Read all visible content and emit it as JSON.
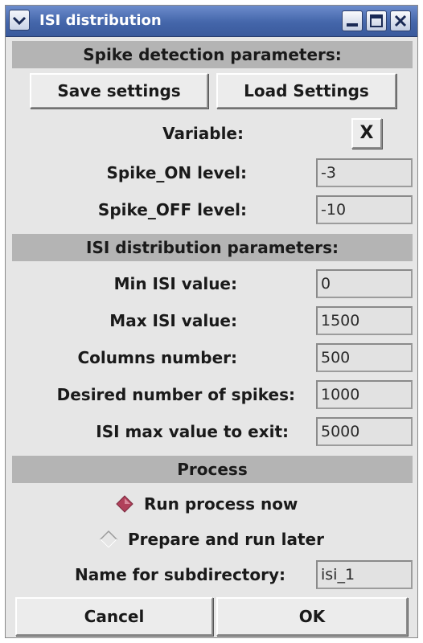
{
  "window": {
    "title": "ISI distribution"
  },
  "spike_section": {
    "header": "Spike detection parameters:",
    "save_label": "Save settings",
    "load_label": "Load Settings",
    "variable_label": "Variable:",
    "variable_value": "X",
    "on_label": "Spike_ON level:",
    "on_value": "-3",
    "off_label": "Spike_OFF level:",
    "off_value": "-10"
  },
  "isi_section": {
    "header": "ISI distribution parameters:",
    "fields": [
      {
        "label": "Min ISI value:",
        "value": "0"
      },
      {
        "label": "Max ISI value:",
        "value": "1500"
      },
      {
        "label": "Columns number:",
        "value": "500"
      },
      {
        "label": "Desired number of spikes:",
        "value": "1000"
      },
      {
        "label": "ISI max value to exit:",
        "value": "5000"
      }
    ]
  },
  "process_section": {
    "header": "Process",
    "options": [
      {
        "label": "Run process now",
        "selected": true
      },
      {
        "label": "Prepare and run later",
        "selected": false
      }
    ],
    "subdir_label": "Name for subdirectory:",
    "subdir_value": "isi_1"
  },
  "footer": {
    "cancel_label": "Cancel",
    "ok_label": "OK"
  },
  "colors": {
    "titlebar": "#4466aa",
    "header_bg": "#b4b4b4",
    "radio_selected": "#b0405a"
  }
}
